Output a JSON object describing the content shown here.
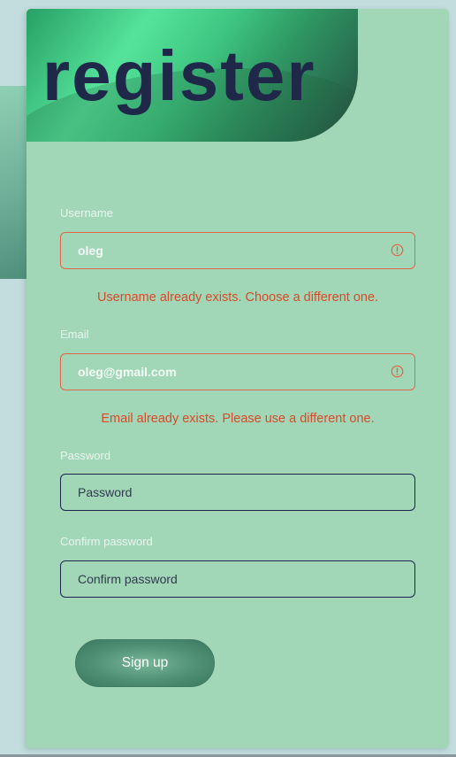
{
  "form": {
    "title": "register",
    "username": {
      "label": "Username",
      "value": "oleg",
      "error": "Username already exists. Choose a different one.",
      "icon": "alert-circle-icon"
    },
    "email": {
      "label": "Email",
      "value": "oleg@gmail.com",
      "error": "Email already exists. Please use a different one.",
      "icon": "alert-circle-icon"
    },
    "password": {
      "label": "Password",
      "placeholder": "Password"
    },
    "confirm_password": {
      "label": "Confirm password",
      "placeholder": "Confirm password"
    },
    "submit_label": "Sign up"
  },
  "colors": {
    "background": "#c3dcdd",
    "card": "#a1d7b6",
    "title": "#20284a",
    "error": "#d9492a",
    "field_border": "#1c2650",
    "field_error_border": "#e26447",
    "button": "#4f8f73"
  }
}
